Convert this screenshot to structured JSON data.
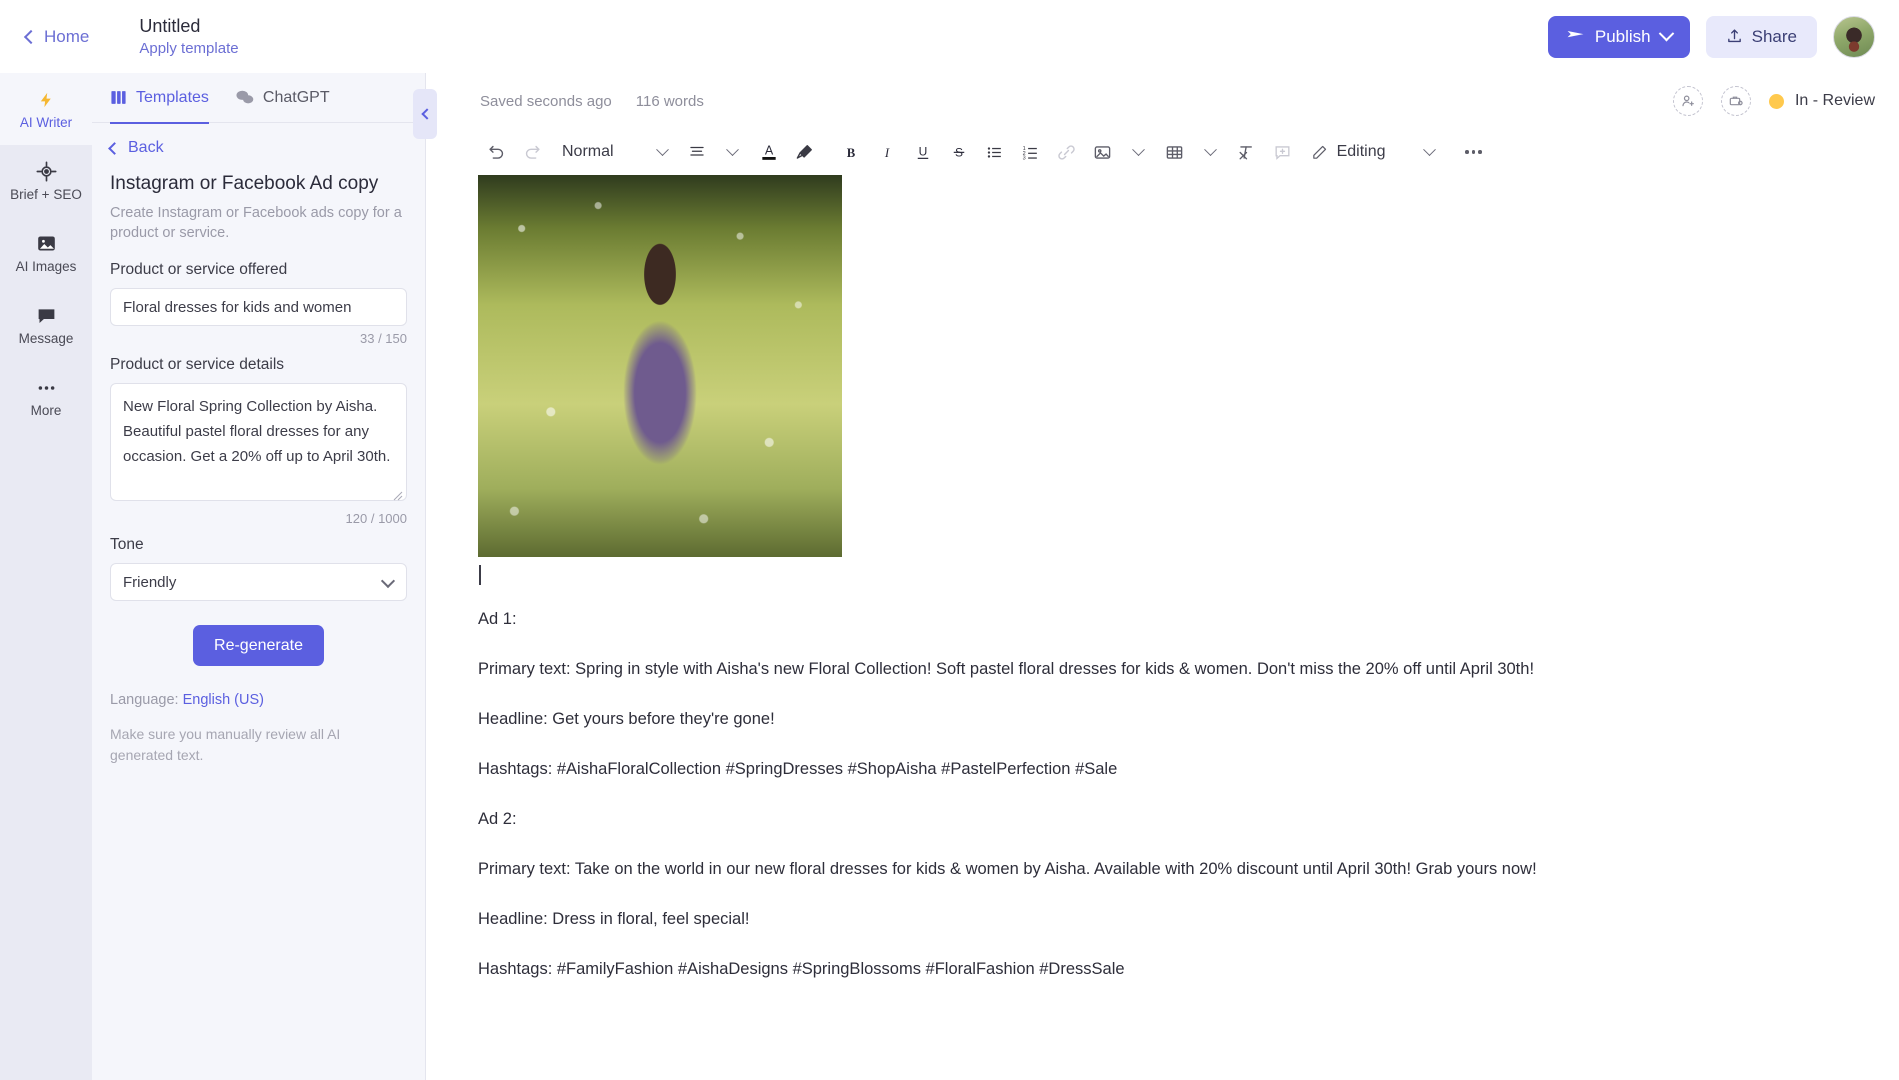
{
  "topbar": {
    "home_label": "Home",
    "doc_title": "Untitled",
    "apply_template_label": "Apply template",
    "publish_label": "Publish",
    "share_label": "Share"
  },
  "rail": {
    "items": [
      {
        "label": "AI Writer",
        "icon": "lightning-icon",
        "active": true
      },
      {
        "label": "Brief + SEO",
        "icon": "target-icon",
        "active": false
      },
      {
        "label": "AI Images",
        "icon": "image-icon",
        "active": false
      },
      {
        "label": "Message",
        "icon": "chat-bubble-icon",
        "active": false
      },
      {
        "label": "More",
        "icon": "ellipsis-icon",
        "active": false
      }
    ]
  },
  "panel": {
    "tabs": [
      {
        "label": "Templates",
        "icon": "grid-icon",
        "active": true
      },
      {
        "label": "ChatGPT",
        "icon": "chat-icon",
        "active": false
      }
    ],
    "back_label": "Back",
    "template_title": "Instagram or Facebook Ad copy",
    "template_description": "Create Instagram or Facebook ads copy for a product or service.",
    "fields": {
      "product_label": "Product or service offered",
      "product_value": "Floral dresses for kids and women",
      "product_counter": "33 / 150",
      "details_label": "Product or service details",
      "details_value": "New Floral Spring Collection by Aisha. Beautiful pastel floral dresses for any occasion. Get a 20% off up to April 30th.",
      "details_counter": "120 / 1000",
      "tone_label": "Tone",
      "tone_value": "Friendly"
    },
    "regenerate_label": "Re-generate",
    "language_prefix": "Language: ",
    "language_value": "English (US)",
    "disclaimer": "Make sure you manually review all AI generated text."
  },
  "editor": {
    "saved_text": "Saved seconds ago",
    "word_count": "116 words",
    "status_label": "In - Review",
    "status_color": "#ffc94d",
    "toolbar": {
      "style_label": "Normal",
      "editing_label": "Editing",
      "buttons": [
        "undo-icon",
        "redo-icon",
        "text-style-dropdown",
        "align-icon",
        "text-color-icon",
        "highlight-icon",
        "bold-icon",
        "italic-icon",
        "underline-icon",
        "strikethrough-icon",
        "bullet-list-icon",
        "numbered-list-icon",
        "link-icon",
        "image-icon",
        "table-icon",
        "clear-format-icon",
        "comment-icon",
        "editing-mode",
        "more-icon"
      ]
    },
    "content": {
      "image_alt": "Girl in floral dress walking through a field of daisies",
      "paragraphs": [
        "Ad 1:",
        "Primary text: Spring in style with Aisha's new Floral Collection! Soft pastel floral dresses for kids & women. Don't miss the 20% off until April 30th!",
        "Headline: Get yours before they're gone!",
        "Hashtags: #AishaFloralCollection #SpringDresses #ShopAisha #PastelPerfection #Sale",
        "Ad 2:",
        "Primary text: Take on the world in our new floral dresses for kids & women by Aisha. Available with 20% discount until April 30th! Grab yours now!",
        "Headline: Dress in floral, feel special!",
        "Hashtags: #FamilyFashion #AishaDesigns #SpringBlossoms #FloralFashion #DressSale"
      ]
    }
  },
  "colors": {
    "accent": "#5b5fe0",
    "panel_bg": "#f5f6fb",
    "rail_bg": "#e9eaf3"
  }
}
